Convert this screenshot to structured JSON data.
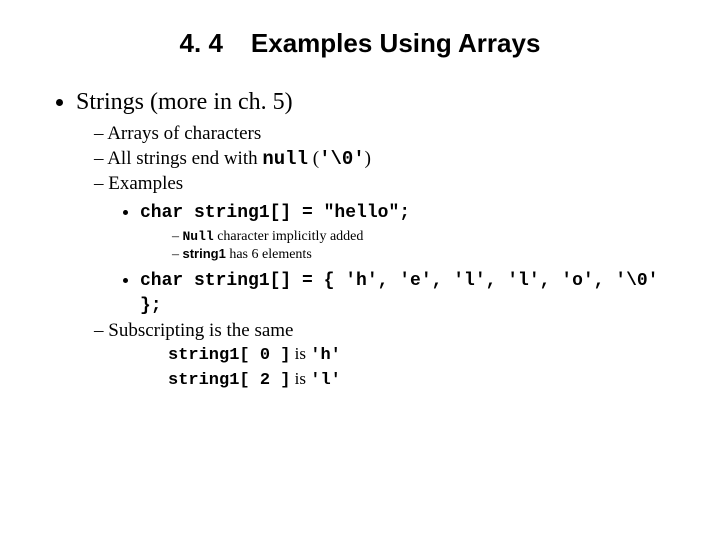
{
  "heading": {
    "num": "4. 4",
    "title": "Examples Using Arrays"
  },
  "b0": "Strings (more in ch. 5)",
  "s1": "Arrays of characters",
  "s2_a": "All strings end with ",
  "s2_b": "null",
  "s2_c": " (",
  "s2_d": "'\\0'",
  "s2_e": ")",
  "s3": "Examples",
  "ex1": "char string1[] = \"hello\";",
  "ex1n1_a": "Null",
  "ex1n1_b": " character implicitly added",
  "ex1n2_a": "string1",
  "ex1n2_b": " has 6 elements",
  "ex2": "char string1[] = { 'h', 'e', 'l', 'l', 'o', '\\0' };",
  "s4": "Subscripting is the same",
  "line1_a": "string1[ 0 ]",
  "line1_b": " is ",
  "line1_c": "'h'",
  "line2_a": "string1[ 2 ]",
  "line2_b": " is ",
  "line2_c": "'l'"
}
